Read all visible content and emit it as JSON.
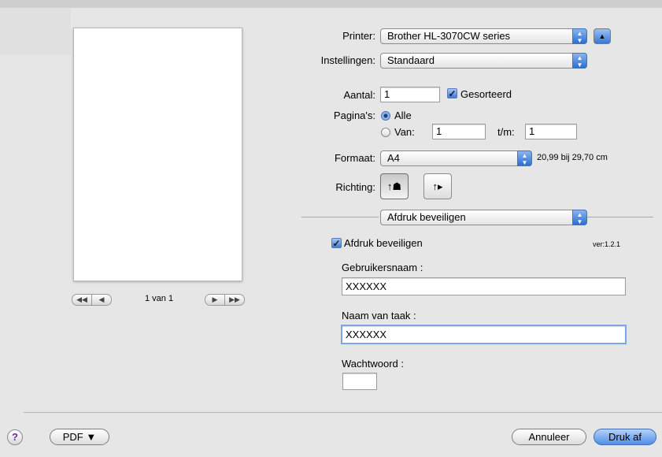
{
  "printer": {
    "label": "Printer:",
    "value": "Brother HL-3070CW series"
  },
  "presets": {
    "label": "Instellingen:",
    "value": "Standaard"
  },
  "copies": {
    "label": "Aantal:",
    "value": "1",
    "collated_label": "Gesorteerd",
    "collated": true
  },
  "pages": {
    "label": "Pagina's:",
    "all_label": "Alle",
    "from_label": "Van:",
    "from_value": "1",
    "to_label": "t/m:",
    "to_value": "1"
  },
  "paper": {
    "label": "Formaat:",
    "value": "A4",
    "size_text": "20,99 bij 29,70 cm"
  },
  "orientation": {
    "label": "Richting:"
  },
  "section": {
    "value": "Afdruk beveiligen"
  },
  "secure": {
    "checkbox_label": "Afdruk beveiligen",
    "checked": true,
    "version": "ver:1.2.1",
    "username_label": "Gebruikersnaam :",
    "username_value": "XXXXXX",
    "jobname_label": "Naam van taak :",
    "jobname_value": "XXXXXX",
    "password_label": "Wachtwoord :",
    "password_value": ""
  },
  "preview": {
    "page_text": "1 van 1"
  },
  "footer": {
    "help": "?",
    "pdf_label": "PDF ▼",
    "cancel_label": "Annuleer",
    "print_label": "Druk af"
  },
  "colors": {
    "accent": "#3778d8",
    "background": "#e6e6e6"
  }
}
